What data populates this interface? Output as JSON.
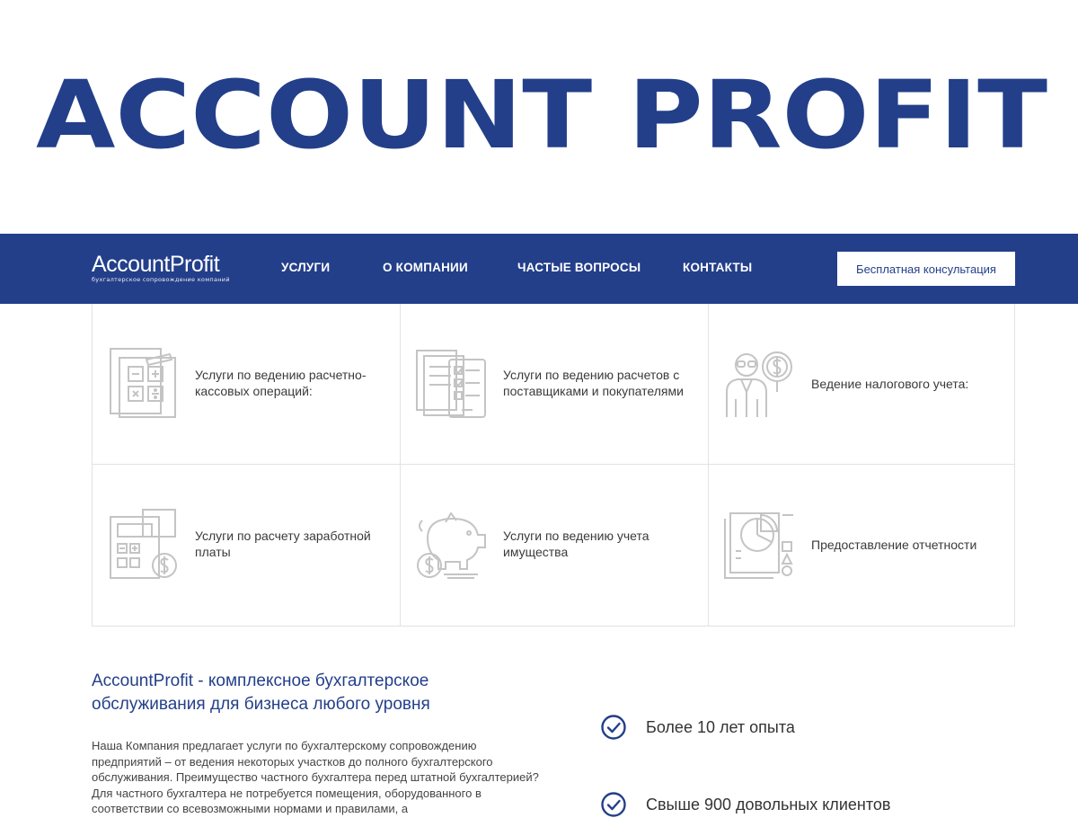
{
  "hero": {
    "title": "ACCOUNT PROFIT"
  },
  "nav": {
    "logo_main": "AccountProfit",
    "logo_sub": "бухгалтерское сопровождение компаний",
    "links": [
      "УСЛУГИ",
      "О КОМПАНИИ",
      "ЧАСТЫЕ ВОПРОСЫ",
      "КОНТАКТЫ"
    ],
    "cta": "Бесплатная консультация"
  },
  "services": [
    {
      "label": "Услуги по ведению расчетно-кассовых операций:",
      "icon": "calculator-documents-icon"
    },
    {
      "label": "Услуги по ведению расчетов с поставщиками и покупателями",
      "icon": "documents-checklist-icon"
    },
    {
      "label": "Ведение налогового учета:",
      "icon": "accountant-dollar-icon"
    },
    {
      "label": "Услуги по расчету заработной платы",
      "icon": "calculator-coin-icon"
    },
    {
      "label": "Услуги по ведению учета имущества",
      "icon": "piggy-bank-icon"
    },
    {
      "label": "Предоставление отчетности",
      "icon": "report-pie-chart-icon"
    }
  ],
  "about": {
    "title": "AccountProfit - комплексное бухгалтерское обслуживания для бизнеса любого уровня",
    "text": "Наша Компания предлагает услуги по бухгалтерскому сопровождению предприятий – от ведения некоторых участков до полного бухгалтерского обслуживания. Преимущество частного бухгалтера перед штатной бухгалтерией? Для частного бухгалтера не потребуется помещения, оборудованного в соответствии со всевозможными нормами и правилами, а"
  },
  "features": [
    "Более 10 лет опыта",
    "Свыше 900 довольных клиентов"
  ],
  "colors": {
    "brand": "#233f8a",
    "icon_gray": "#c4c4c4",
    "border": "#e2e2e2"
  }
}
